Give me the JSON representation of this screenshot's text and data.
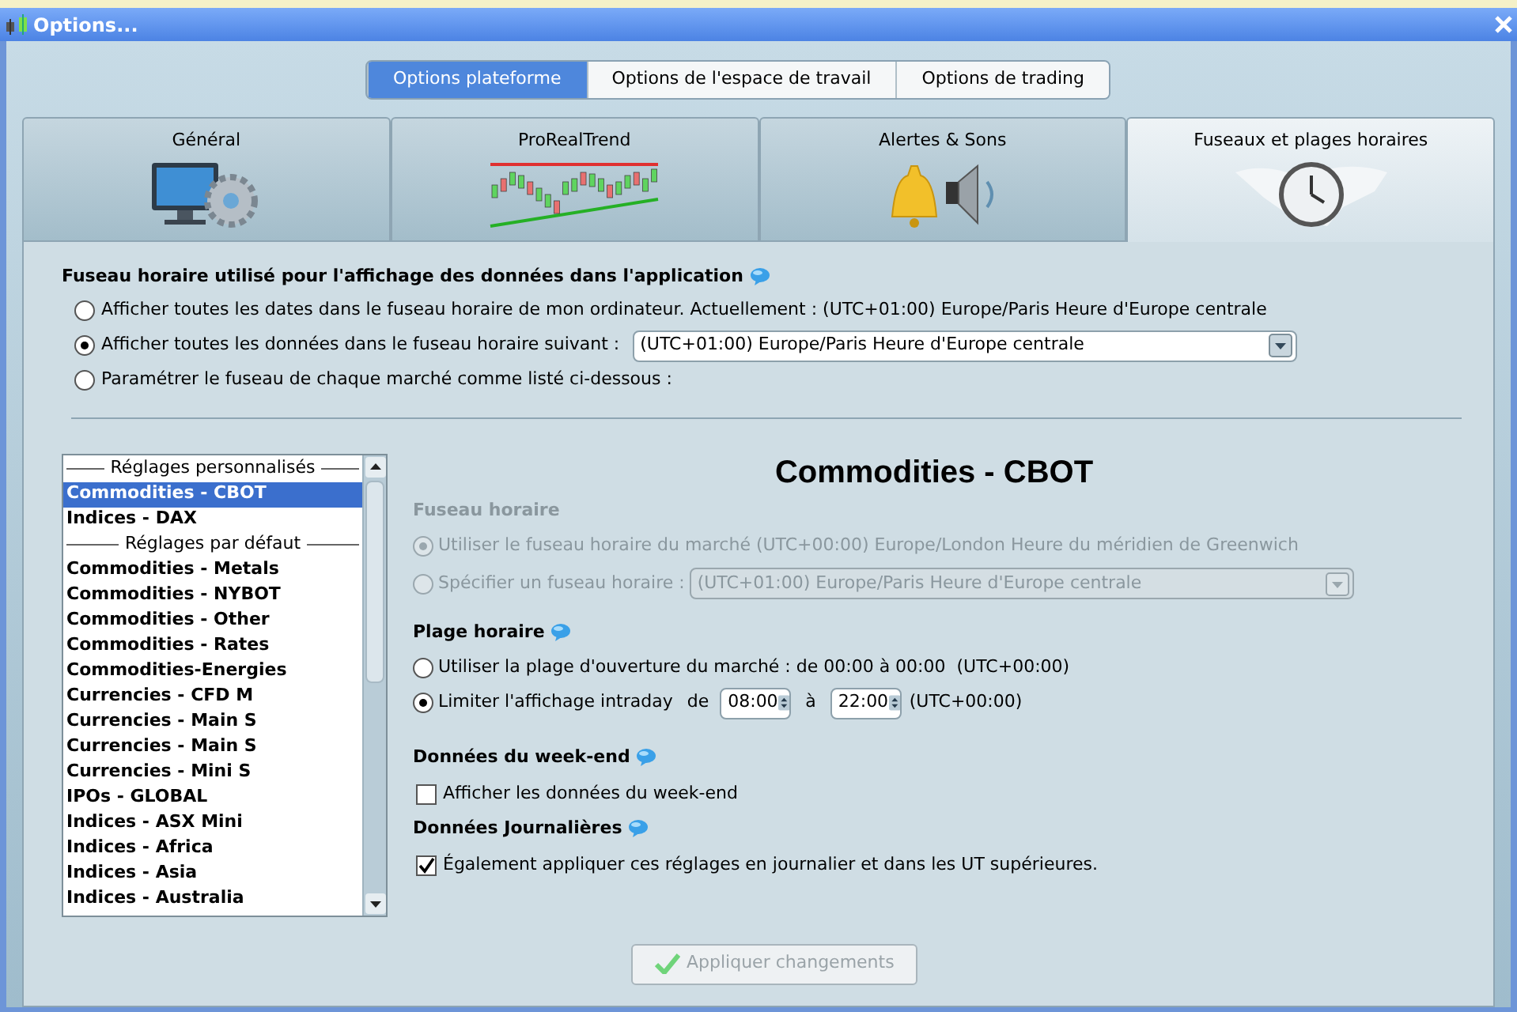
{
  "window": {
    "title": "Options..."
  },
  "top_tabs": [
    {
      "label": "Options plateforme",
      "selected": true
    },
    {
      "label": "Options de l'espace de travail",
      "selected": false
    },
    {
      "label": "Options de trading",
      "selected": false
    }
  ],
  "section_tabs": [
    {
      "label": "Général",
      "selected": false
    },
    {
      "label": "ProRealTrend",
      "selected": false
    },
    {
      "label": "Alertes & Sons",
      "selected": false
    },
    {
      "label": "Fuseaux et plages horaires",
      "selected": true
    }
  ],
  "display_timezone": {
    "heading": "Fuseau horaire utilisé pour l'affichage des données dans l'application",
    "options": [
      {
        "label": "Afficher toutes les dates dans le fuseau horaire de mon ordinateur. Actuellement : (UTC+01:00) Europe/Paris Heure d'Europe centrale",
        "selected": false
      },
      {
        "label": "Afficher toutes les données dans le fuseau horaire suivant :",
        "selected": true,
        "dropdown": "(UTC+01:00) Europe/Paris Heure d'Europe centrale"
      },
      {
        "label": "Paramétrer le fuseau de chaque marché comme listé ci-dessous :",
        "selected": false
      }
    ]
  },
  "market_list": [
    {
      "kind": "header",
      "label": "Réglages personnalisés"
    },
    {
      "kind": "item",
      "label": "Commodities - CBOT",
      "selected": true
    },
    {
      "kind": "item",
      "label": "Indices - DAX",
      "selected": false
    },
    {
      "kind": "header",
      "label": "Réglages par défaut"
    },
    {
      "kind": "item",
      "label": "Commodities - Metals",
      "selected": false
    },
    {
      "kind": "item",
      "label": "Commodities - NYBOT",
      "selected": false
    },
    {
      "kind": "item",
      "label": "Commodities - Other",
      "selected": false
    },
    {
      "kind": "item",
      "label": "Commodities - Rates",
      "selected": false
    },
    {
      "kind": "item",
      "label": "Commodities-Energies",
      "selected": false
    },
    {
      "kind": "item",
      "label": "Currencies - CFD M",
      "selected": false
    },
    {
      "kind": "item",
      "label": "Currencies - Main S",
      "selected": false
    },
    {
      "kind": "item",
      "label": "Currencies - Main S",
      "selected": false
    },
    {
      "kind": "item",
      "label": "Currencies - Mini S",
      "selected": false
    },
    {
      "kind": "item",
      "label": "IPOs - GLOBAL",
      "selected": false
    },
    {
      "kind": "item",
      "label": "Indices - ASX Mini",
      "selected": false
    },
    {
      "kind": "item",
      "label": "Indices - Africa",
      "selected": false
    },
    {
      "kind": "item",
      "label": "Indices - Asia",
      "selected": false
    },
    {
      "kind": "item",
      "label": "Indices - Australia",
      "selected": false
    }
  ],
  "market_settings": {
    "title": "Commodities - CBOT",
    "timezone": {
      "heading": "Fuseau horaire",
      "disabled": true,
      "options": [
        {
          "label": "Utiliser le fuseau horaire du marché (UTC+00:00) Europe/London Heure du méridien de Greenwich",
          "selected": true
        },
        {
          "label": "Spécifier un fuseau horaire :",
          "selected": false,
          "dropdown": "(UTC+01:00) Europe/Paris Heure d'Europe centrale"
        }
      ]
    },
    "hours": {
      "heading": "Plage horaire",
      "market_option": {
        "label": "Utiliser la plage d'ouverture du marché : de 00:00 à 00:00  (UTC+00:00)",
        "selected": false
      },
      "limit_option": {
        "label": "Limiter l'affichage intraday",
        "selected": true,
        "from_label": "de",
        "from": "08:00",
        "to_label": "à",
        "to": "22:00",
        "tz": "(UTC+00:00)"
      }
    },
    "weekend": {
      "heading": "Données du week-end",
      "checkbox": {
        "label": "Afficher les données du week-end",
        "checked": false
      }
    },
    "daily": {
      "heading": "Données Journalières",
      "checkbox": {
        "label": "Également appliquer ces réglages en journalier et dans les UT supérieures.",
        "checked": true
      }
    },
    "apply_button": {
      "label": "Appliquer changements",
      "disabled": true
    }
  }
}
